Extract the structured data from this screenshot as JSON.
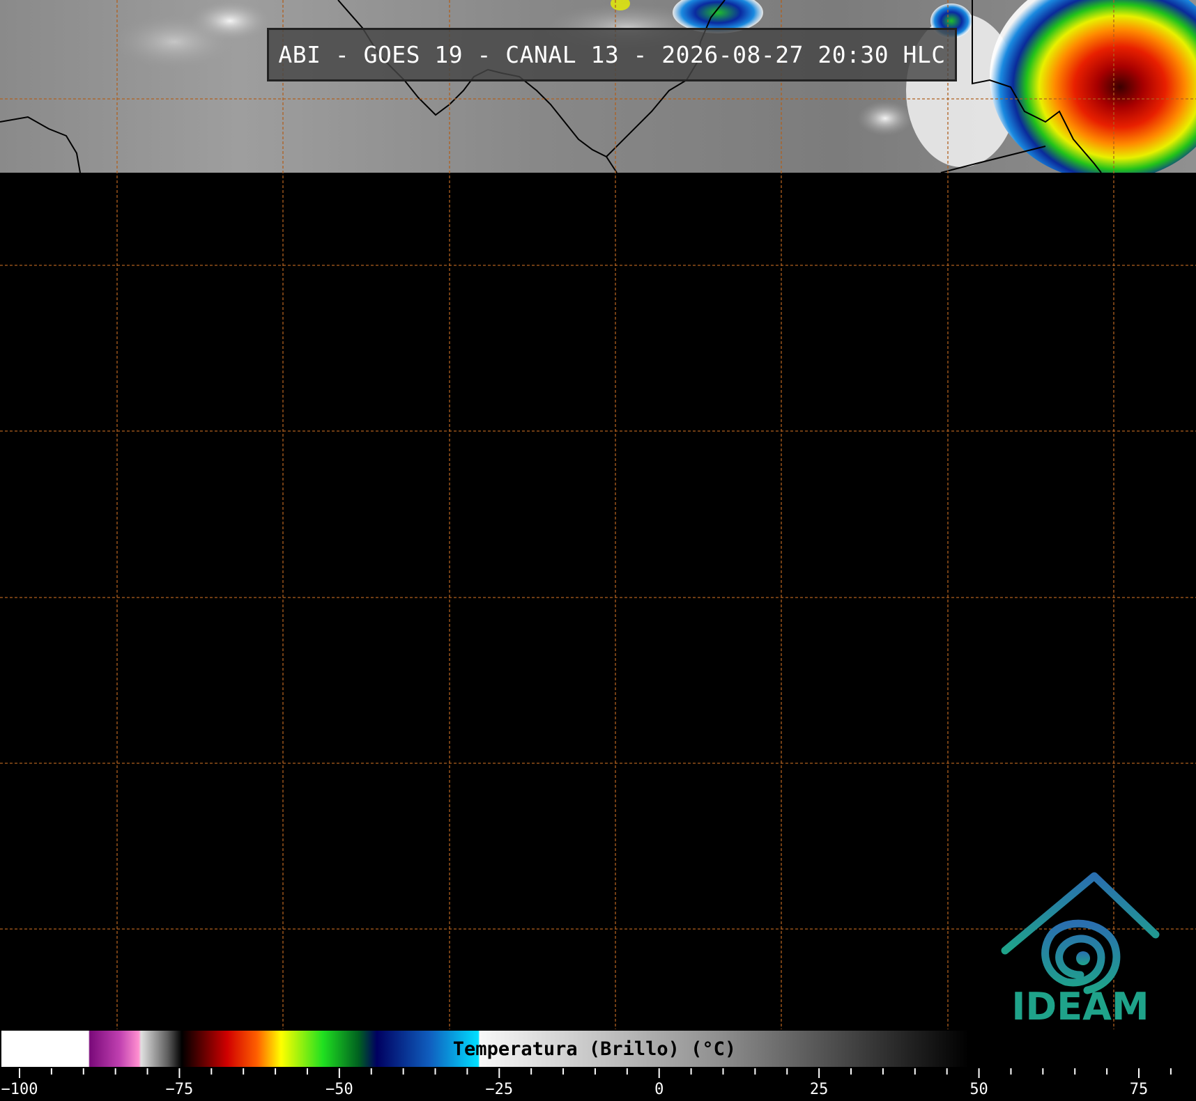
{
  "title": "ABI - GOES 19 - CANAL 13 - 2026-08-27 20:30 HLC",
  "colorbar": {
    "label": "Temperatura (Brillo) (°C)",
    "ticks": [
      "−100",
      "−75",
      "−50",
      "−25",
      "0",
      "25",
      "50",
      "75"
    ],
    "tick_values": [
      -100,
      -75,
      -50,
      -25,
      0,
      25,
      50,
      75
    ],
    "range": [
      -103,
      84
    ]
  },
  "logo": {
    "text": "IDEAM",
    "icon": "ideam-swirl-logo-icon"
  },
  "colors": {
    "grid": "#b0601f",
    "logo_teal": "#1fa38a",
    "logo_blue": "#2a6fb0"
  }
}
